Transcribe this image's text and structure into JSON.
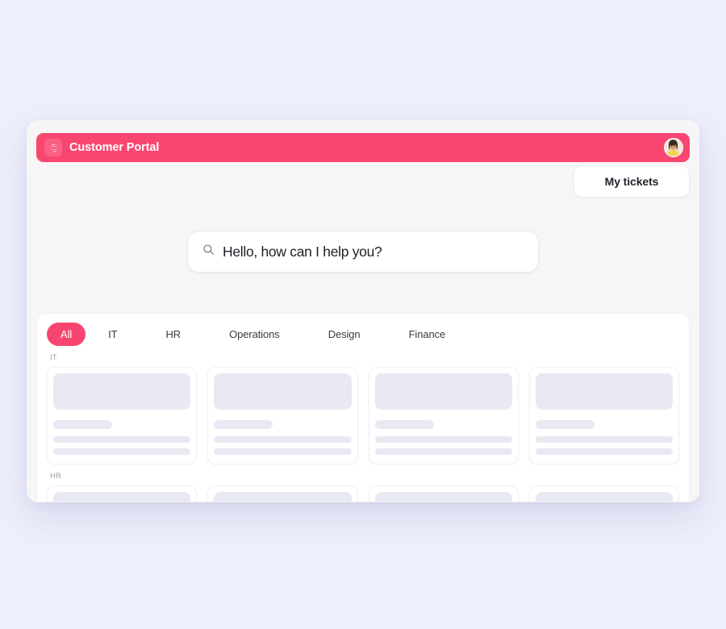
{
  "app": {
    "brand_color": "#f94670",
    "accent_color": "#f6466f",
    "page_background": "#edeffc",
    "title": "Customer Portal",
    "logo_icon": "s-lightning-logo-icon",
    "avatar_alt": "user-avatar"
  },
  "header": {
    "my_tickets_label": "My tickets"
  },
  "search": {
    "value": "Hello, how can I help you?",
    "placeholder": "Hello, how can I help you?",
    "icon": "search-icon"
  },
  "tabs": [
    {
      "label": "All",
      "active": true
    },
    {
      "label": "IT",
      "active": false
    },
    {
      "label": "HR",
      "active": false
    },
    {
      "label": "Operations",
      "active": false
    },
    {
      "label": "Design",
      "active": false
    },
    {
      "label": "Finance",
      "active": false
    }
  ],
  "groups": [
    {
      "label": "IT",
      "cards": [
        {
          "state": "loading"
        },
        {
          "state": "loading"
        },
        {
          "state": "loading"
        },
        {
          "state": "loading"
        }
      ]
    },
    {
      "label": "HR",
      "cards": [
        {
          "state": "loading"
        },
        {
          "state": "loading"
        },
        {
          "state": "loading"
        },
        {
          "state": "loading"
        }
      ]
    }
  ]
}
